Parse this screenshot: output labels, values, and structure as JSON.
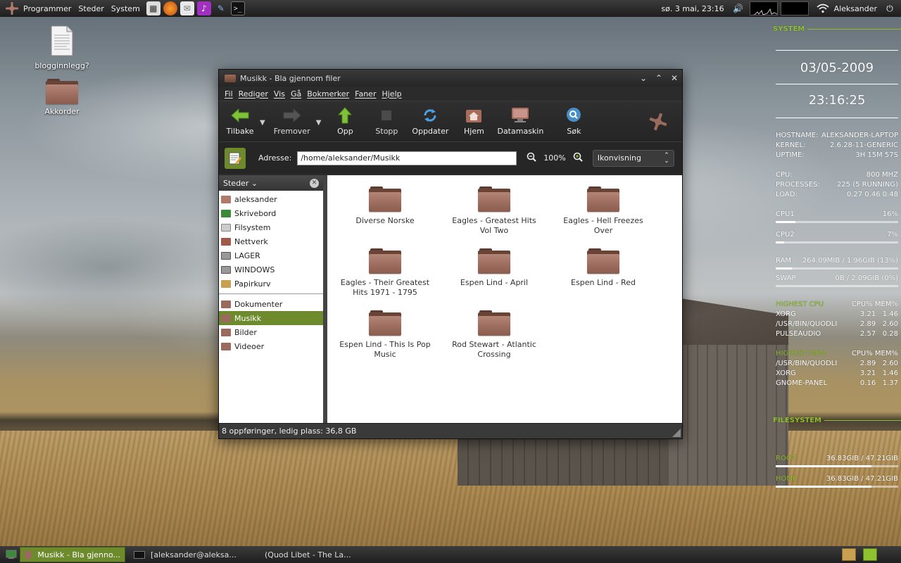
{
  "top_panel": {
    "menus": [
      "Programmer",
      "Steder",
      "System"
    ],
    "clock": "sø.  3 mai, 23:16",
    "user": "Aleksander"
  },
  "desktop": {
    "icons": [
      {
        "label": "blogginnlegg?",
        "icon": "text-document-icon"
      },
      {
        "label": "Akkorder",
        "icon": "folder-icon"
      }
    ]
  },
  "window": {
    "title": "Musikk - Bla gjennom filer",
    "menus": [
      "Fil",
      "Rediger",
      "Vis",
      "Gå",
      "Bokmerker",
      "Faner",
      "Hjelp"
    ],
    "toolbar": {
      "back": "Tilbake",
      "forward": "Fremover",
      "up": "Opp",
      "stop": "Stopp",
      "reload": "Oppdater",
      "home": "Hjem",
      "computer": "Datamaskin",
      "search": "Søk"
    },
    "address_label": "Adresse:",
    "address_value": "/home/aleksander/Musikk",
    "zoom": "100%",
    "view_mode": "Ikonvisning",
    "sidebar": {
      "header": "Steder",
      "items": [
        {
          "label": "aleksander",
          "icon": "home-icon",
          "color": "#b07a6a"
        },
        {
          "label": "Skrivebord",
          "icon": "desktop-icon",
          "color": "#3a8a3a"
        },
        {
          "label": "Filsystem",
          "icon": "drive-icon",
          "color": "#bbbbbb"
        },
        {
          "label": "Nettverk",
          "icon": "network-icon",
          "color": "#a05a4a"
        },
        {
          "label": "LAGER",
          "icon": "harddisk-icon",
          "color": "#888888"
        },
        {
          "label": "WINDOWS",
          "icon": "harddisk-icon",
          "color": "#888888"
        },
        {
          "label": "Papirkurv",
          "icon": "trash-icon",
          "color": "#c8a050"
        }
      ],
      "bookmarks": [
        {
          "label": "Dokumenter",
          "active": false
        },
        {
          "label": "Musikk",
          "active": true
        },
        {
          "label": "Bilder",
          "active": false
        },
        {
          "label": "Videoer",
          "active": false
        }
      ]
    },
    "files": [
      "Diverse Norske",
      "Eagles - Greatest Hits Vol Two",
      "Eagles - Hell Freezes Over",
      "Eagles - Their Greatest Hits 1971 - 1795",
      "Espen Lind - April",
      "Espen Lind - Red",
      "Espen Lind - This Is Pop Music",
      "Rod Stewart - Atlantic Crossing"
    ],
    "status": "8 oppføringer, ledig plass: 36,8 GB"
  },
  "conky": {
    "system_label": "SYSTEM",
    "date": "03/05-2009",
    "time": "23:16:25",
    "hostname_label": "HOSTNAME:",
    "hostname": "ALEKSANDER-LAPTOP",
    "kernel_label": "KERNEL:",
    "kernel": "2.6.28-11-GENERIC",
    "uptime_label": "UPTIME:",
    "uptime": "3H 15M 57S",
    "cpu_label": "CPU:",
    "cpu_freq": "800 MHZ",
    "processes_label": "PROCESSES:",
    "processes": "225 (5 RUNNING)",
    "load_label": "LOAD:",
    "load": "0.27 0.46 0.48",
    "cpu1_label": "CPU1",
    "cpu1": "16%",
    "cpu1_level": 0.16,
    "cpu2_label": "CPU2",
    "cpu2": "7%",
    "cpu2_level": 0.07,
    "ram_label": "RAM",
    "ram": "264.09MIB / 1.96GIB (13%)",
    "ram_level": 0.13,
    "swap_label": "SWAP",
    "swap": "0B / 2.09GIB (0%)",
    "swap_level": 0.0,
    "highest_cpu": {
      "title": "HIGHEST CPU",
      "cols": "CPU% MEM%",
      "rows": [
        {
          "name": "XORG",
          "cpu": "3.21",
          "mem": "1.46"
        },
        {
          "name": "/USR/BIN/QUODLI",
          "cpu": "2.89",
          "mem": "2.60"
        },
        {
          "name": "PULSEAUDIO",
          "cpu": "2.57",
          "mem": "0.28"
        }
      ]
    },
    "highest_mem": {
      "title": "HIGHEST MEM",
      "cols": "CPU% MEM%",
      "rows": [
        {
          "name": "/USR/BIN/QUODLI",
          "cpu": "2.89",
          "mem": "2.60"
        },
        {
          "name": "XORG",
          "cpu": "3.21",
          "mem": "1.46"
        },
        {
          "name": "GNOME-PANEL",
          "cpu": "0.16",
          "mem": "1.37"
        }
      ]
    },
    "filesystem_label": "FILESYSTEM",
    "root_label": "ROOT",
    "root": "36.83GIB / 47.21GIB",
    "root_level": 0.78,
    "home_label": "HOME",
    "home": "36.83GIB / 47.21GIB",
    "home_level": 0.78
  },
  "taskbar": {
    "tasks": [
      {
        "label": "Musikk - Bla gjenno...",
        "active": true
      },
      {
        "label": "[aleksander@aleksa...",
        "active": false
      },
      {
        "label": "(Quod Libet - The La...",
        "active": false
      }
    ]
  },
  "colors": {
    "accent": "#6d8b2d",
    "conky_heading": "#8fbf2f",
    "folder": "#9a6b5c"
  }
}
